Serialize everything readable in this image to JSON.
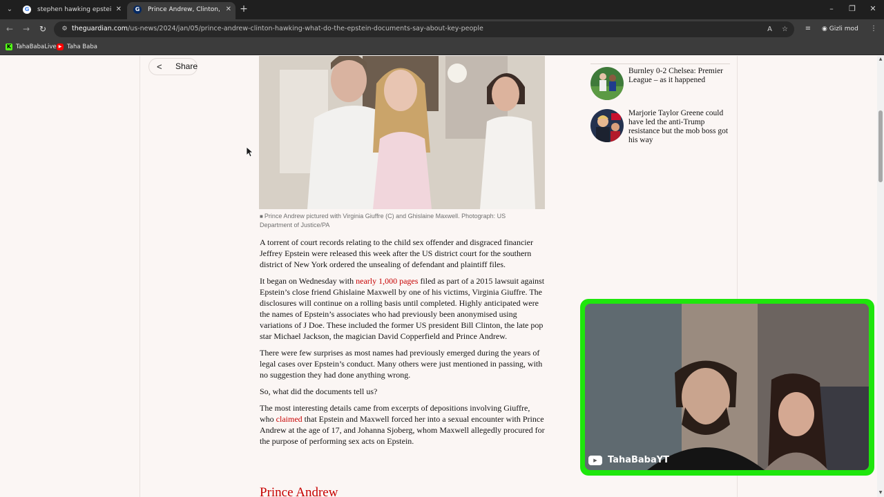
{
  "browser": {
    "tabs": [
      {
        "title": "stephen hawking epstein case",
        "favicon": "google-g-icon",
        "active": false
      },
      {
        "title": "Prince Andrew, Clinton, Hawking",
        "favicon": "guardian-g-icon",
        "active": true
      }
    ],
    "url_domain": "theguardian.com",
    "url_path": "/us-news/2024/jan/05/prince-andrew-clinton-hawking-what-do-the-epstein-documents-say-about-key-people",
    "incognito_label": "Gizli mod",
    "bookmarks": [
      {
        "label": "TahaBabaLive",
        "icon": "kick-icon"
      },
      {
        "label": "Taha Baba",
        "icon": "youtube-icon"
      }
    ]
  },
  "article": {
    "share_label": "Share",
    "photo_caption": "Prince Andrew pictured with Virginia Giuffre (C) and Ghislaine Maxwell. Photograph: US Department of Justice/PA",
    "paragraphs": {
      "p1": "A torrent of court records relating to the child sex offender and disgraced financier Jeffrey Epstein were released this week after the US district court for the southern district of New York ordered the unsealing of defendant and plaintiff files.",
      "p2_before": "It began on Wednesday with ",
      "p2_link": "nearly 1,000 pages",
      "p2_after": " filed as part of a 2015 lawsuit against Epstein’s close friend Ghislaine Maxwell by one of his victims, Virginia Giuffre. The disclosures will continue on a rolling basis until completed. Highly anticipated were the names of Epstein’s associates who had previously been anonymised using variations of J Doe. These included the former US president Bill Clinton, the late pop star Michael Jackson, the magician David Copperfield and Prince Andrew.",
      "p3": "There were few surprises as most names had previously emerged during the years of legal cases over Epstein’s conduct. Many others were just mentioned in passing, with no suggestion they had done anything wrong.",
      "p4": "So, what did the documents tell us?",
      "p5_before": "The most interesting details came from excerpts of depositions involving Giuffre, who ",
      "p5_link": "claimed",
      "p5_after": " that Epstein and Maxwell forced her into a sexual encounter with Prince Andrew at the age of 17, and Johanna Sjoberg, whom Maxwell allegedly procured for the purpose of performing sex acts on Epstein."
    },
    "subheading": "Prince Andrew"
  },
  "related": [
    {
      "title": "Burnley 0-2 Chelsea: Premier League – as it happened"
    },
    {
      "title": "Marjorie Taylor Greene could have led the anti-Trump resistance but the mob boss got his way"
    }
  ],
  "webcam": {
    "channel_label": "TahaBabaYT",
    "frame_color": "#1ee60c"
  },
  "colors": {
    "page_bg": "#fbf6f4",
    "link": "#c70000",
    "chrome_dark": "#1f1f1f",
    "chrome_toolbar": "#3c3c3c"
  }
}
